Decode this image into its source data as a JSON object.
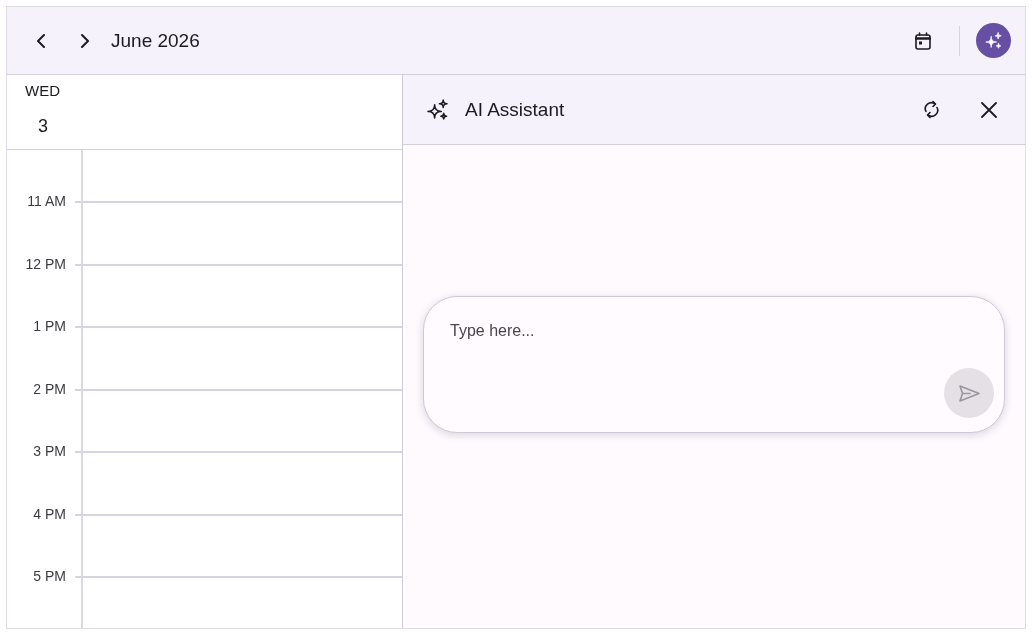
{
  "header": {
    "title": "June 2026",
    "ai_button": {
      "active": true
    }
  },
  "day": {
    "weekday": "WED",
    "date": "3"
  },
  "time_slots": [
    "11 AM",
    "12 PM",
    "1 PM",
    "2 PM",
    "3 PM",
    "4 PM",
    "5 PM"
  ],
  "assistant": {
    "title": "AI Assistant",
    "input": {
      "placeholder": "Type here..."
    },
    "send_button": {
      "disabled": true
    }
  }
}
